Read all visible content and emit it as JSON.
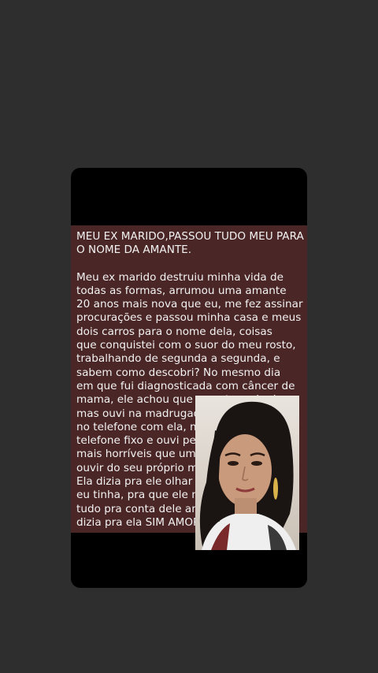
{
  "post": {
    "headline": "MEU EX MARIDO,PASSOU TUDO MEU PARA\nO NOME DA AMANTE.",
    "body": "Meu ex marido destruiu minha vida de\ntodas as formas, arrumou uma amante\n20 anos mais nova que eu, me fez assinar\nprocurações e passou minha casa e meus\ndois carros para o nome dela, coisas\nque conquistei com o suor do meu rosto,\ntrabalhando de segunda a segunda, e\nsabem como descobri? No mesmo dia\nem que fui diagnosticada com câncer de\nmama, ele achou que eu estava d     ndo,\nmas ouvi na madrugada uma           ele\nno telefone com ela, na époc\ntelefone fixo e ouvi pela exte\nmais horríveis que uma mul\nouvir do seu próprio marido\nEla dizia pra ele olhar nos b\neu tinha, pra que ele me\ntudo pra conta dele ant\ndizia pra ela SIM AMOR"
  },
  "colors": {
    "background": "#2e2e2e",
    "card": "#000000",
    "post_background": "#4b2626",
    "post_text": "#f2f2f2"
  }
}
